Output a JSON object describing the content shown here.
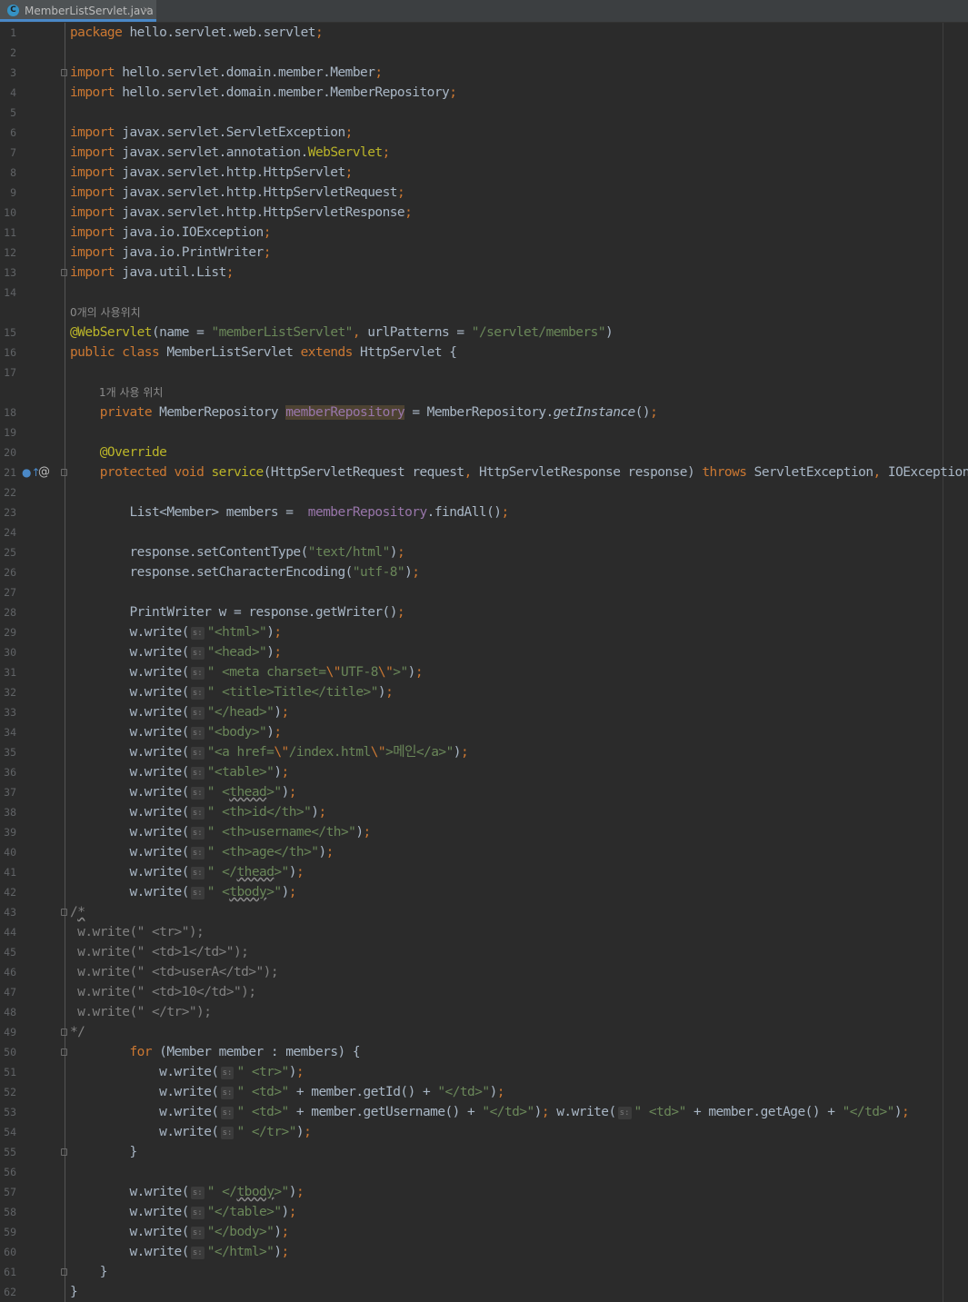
{
  "tab": {
    "icon": "class-icon",
    "title": "MemberListServlet.java"
  },
  "hints": {
    "class_usages": "0개의 사용위치",
    "field_usages": "1개 사용 위치"
  },
  "gutter": {
    "override_icon": "override-up-arrow-icon",
    "at_icon": "annotation-at-icon"
  },
  "param_hint": "s:",
  "lines": [
    {
      "n": "1",
      "hint": null,
      "parts": [
        [
          "package",
          "kw"
        ],
        [
          " hello.servlet.web.servlet",
          ""
        ],
        [
          ";",
          "kw"
        ]
      ]
    },
    {
      "n": "2",
      "hint": null,
      "parts": []
    },
    {
      "n": "3",
      "hint": null,
      "parts": [
        [
          "import",
          "kw"
        ],
        [
          " hello.servlet.domain.member.Member",
          ""
        ],
        [
          ";",
          "kw"
        ]
      ]
    },
    {
      "n": "4",
      "hint": null,
      "parts": [
        [
          "import",
          "kw"
        ],
        [
          " hello.servlet.domain.member.MemberRepository",
          ""
        ],
        [
          ";",
          "kw"
        ]
      ]
    },
    {
      "n": "5",
      "hint": null,
      "parts": []
    },
    {
      "n": "6",
      "hint": null,
      "parts": [
        [
          "import",
          "kw"
        ],
        [
          " javax.servlet.ServletException",
          ""
        ],
        [
          ";",
          "kw"
        ]
      ]
    },
    {
      "n": "7",
      "hint": null,
      "parts": [
        [
          "import",
          "kw"
        ],
        [
          " javax.servlet.annotation.",
          ""
        ],
        [
          "WebServlet",
          "ann"
        ],
        [
          ";",
          "kw"
        ]
      ]
    },
    {
      "n": "8",
      "hint": null,
      "parts": [
        [
          "import",
          "kw"
        ],
        [
          " javax.servlet.http.HttpServlet",
          ""
        ],
        [
          ";",
          "kw"
        ]
      ]
    },
    {
      "n": "9",
      "hint": null,
      "parts": [
        [
          "import",
          "kw"
        ],
        [
          " javax.servlet.http.HttpServletRequest",
          ""
        ],
        [
          ";",
          "kw"
        ]
      ]
    },
    {
      "n": "10",
      "hint": null,
      "parts": [
        [
          "import",
          "kw"
        ],
        [
          " javax.servlet.http.HttpServletResponse",
          ""
        ],
        [
          ";",
          "kw"
        ]
      ]
    },
    {
      "n": "11",
      "hint": null,
      "parts": [
        [
          "import",
          "kw"
        ],
        [
          " java.io.IOException",
          ""
        ],
        [
          ";",
          "kw"
        ]
      ]
    },
    {
      "n": "12",
      "hint": null,
      "parts": [
        [
          "import",
          "kw"
        ],
        [
          " java.io.PrintWriter",
          ""
        ],
        [
          ";",
          "kw"
        ]
      ]
    },
    {
      "n": "13",
      "hint": null,
      "parts": [
        [
          "import",
          "kw"
        ],
        [
          " java.util.List",
          ""
        ],
        [
          ";",
          "kw"
        ]
      ]
    },
    {
      "n": "14",
      "hint": null,
      "parts": []
    },
    {
      "n": "",
      "hint": "class_usages",
      "parts": []
    },
    {
      "n": "15",
      "hint": null,
      "parts": [
        [
          "@WebServlet",
          "ann"
        ],
        [
          "(name = ",
          ""
        ],
        [
          "\"memberListServlet\"",
          "str"
        ],
        [
          ", ",
          "kw"
        ],
        [
          "urlPatterns = ",
          ""
        ],
        [
          "\"/servlet/members\"",
          "str"
        ],
        [
          ")",
          ""
        ]
      ]
    },
    {
      "n": "16",
      "hint": null,
      "parts": [
        [
          "public class",
          "kw"
        ],
        [
          " MemberListServlet ",
          ""
        ],
        [
          "extends",
          "kw"
        ],
        [
          " HttpServlet {",
          ""
        ]
      ]
    },
    {
      "n": "17",
      "hint": null,
      "parts": []
    },
    {
      "n": "",
      "hint": "field_usages",
      "parts": []
    },
    {
      "n": "18",
      "hint": null,
      "parts": [
        [
          "    ",
          ""
        ],
        [
          "private",
          "kw"
        ],
        [
          " MemberRepository ",
          ""
        ],
        [
          "memberRepository",
          "fld hl"
        ],
        [
          " = MemberRepository.",
          ""
        ],
        [
          "getInstance",
          "it"
        ],
        [
          "()",
          ""
        ],
        [
          ";",
          "kw"
        ]
      ]
    },
    {
      "n": "19",
      "hint": null,
      "parts": []
    },
    {
      "n": "20",
      "hint": null,
      "parts": [
        [
          "    ",
          ""
        ],
        [
          "@Override",
          "ann"
        ]
      ]
    },
    {
      "n": "21",
      "hint": null,
      "parts": [
        [
          "    ",
          ""
        ],
        [
          "protected void",
          "kw"
        ],
        [
          " ",
          ""
        ],
        [
          "service",
          "ann"
        ],
        [
          "(HttpServletRequest request",
          ""
        ],
        [
          ", ",
          "kw"
        ],
        [
          "HttpServletResponse response) ",
          ""
        ],
        [
          "throws",
          "kw"
        ],
        [
          " ServletException",
          ""
        ],
        [
          ", ",
          "kw"
        ],
        [
          "IOException {",
          ""
        ]
      ]
    },
    {
      "n": "22",
      "hint": null,
      "parts": []
    },
    {
      "n": "23",
      "hint": null,
      "parts": [
        [
          "        List<Member> members =  ",
          ""
        ],
        [
          "memberRepository",
          "fld"
        ],
        [
          ".findAll()",
          ""
        ],
        [
          ";",
          "kw"
        ]
      ]
    },
    {
      "n": "24",
      "hint": null,
      "parts": []
    },
    {
      "n": "25",
      "hint": null,
      "parts": [
        [
          "        response.setContentType(",
          ""
        ],
        [
          "\"text/html\"",
          "str"
        ],
        [
          ")",
          ""
        ],
        [
          ";",
          "kw"
        ]
      ]
    },
    {
      "n": "26",
      "hint": null,
      "parts": [
        [
          "        response.setCharacterEncoding(",
          ""
        ],
        [
          "\"utf-8\"",
          "str"
        ],
        [
          ")",
          ""
        ],
        [
          ";",
          "kw"
        ]
      ]
    },
    {
      "n": "27",
      "hint": null,
      "parts": []
    },
    {
      "n": "28",
      "hint": null,
      "parts": [
        [
          "        PrintWriter w = response.getWriter()",
          ""
        ],
        [
          ";",
          "kw"
        ]
      ]
    },
    {
      "n": "29",
      "hint": null,
      "parts": [
        [
          "        w.write(",
          ""
        ],
        [
          "",
          "ph"
        ],
        [
          "\"<html>\"",
          "str"
        ],
        [
          ")",
          ""
        ],
        [
          ";",
          "kw"
        ]
      ]
    },
    {
      "n": "30",
      "hint": null,
      "parts": [
        [
          "        w.write(",
          ""
        ],
        [
          "",
          "ph"
        ],
        [
          "\"<head>\"",
          "str"
        ],
        [
          ")",
          ""
        ],
        [
          ";",
          "kw"
        ]
      ]
    },
    {
      "n": "31",
      "hint": null,
      "parts": [
        [
          "        w.write(",
          ""
        ],
        [
          "",
          "ph"
        ],
        [
          "\" <meta charset=",
          "str"
        ],
        [
          "\\\"",
          "kw"
        ],
        [
          "UTF-8",
          "str"
        ],
        [
          "\\\"",
          "kw"
        ],
        [
          ">\"",
          "str"
        ],
        [
          ")",
          ""
        ],
        [
          ";",
          "kw"
        ]
      ]
    },
    {
      "n": "32",
      "hint": null,
      "parts": [
        [
          "        w.write(",
          ""
        ],
        [
          "",
          "ph"
        ],
        [
          "\" <title>Title</title>\"",
          "str"
        ],
        [
          ")",
          ""
        ],
        [
          ";",
          "kw"
        ]
      ]
    },
    {
      "n": "33",
      "hint": null,
      "parts": [
        [
          "        w.write(",
          ""
        ],
        [
          "",
          "ph"
        ],
        [
          "\"</head>\"",
          "str"
        ],
        [
          ")",
          ""
        ],
        [
          ";",
          "kw"
        ]
      ]
    },
    {
      "n": "34",
      "hint": null,
      "parts": [
        [
          "        w.write(",
          ""
        ],
        [
          "",
          "ph"
        ],
        [
          "\"<body>\"",
          "str"
        ],
        [
          ")",
          ""
        ],
        [
          ";",
          "kw"
        ]
      ]
    },
    {
      "n": "35",
      "hint": null,
      "parts": [
        [
          "        w.write(",
          ""
        ],
        [
          "",
          "ph"
        ],
        [
          "\"<a href=",
          "str"
        ],
        [
          "\\\"",
          "kw"
        ],
        [
          "/index.html",
          "str"
        ],
        [
          "\\\"",
          "kw"
        ],
        [
          ">메인</a>\"",
          "str"
        ],
        [
          ")",
          ""
        ],
        [
          ";",
          "kw"
        ]
      ]
    },
    {
      "n": "36",
      "hint": null,
      "parts": [
        [
          "        w.write(",
          ""
        ],
        [
          "",
          "ph"
        ],
        [
          "\"<table>\"",
          "str"
        ],
        [
          ")",
          ""
        ],
        [
          ";",
          "kw"
        ]
      ]
    },
    {
      "n": "37",
      "hint": null,
      "parts": [
        [
          "        w.write(",
          ""
        ],
        [
          "",
          "ph"
        ],
        [
          "\" <",
          "str"
        ],
        [
          "thead",
          "str u"
        ],
        [
          ">\"",
          "str"
        ],
        [
          ")",
          ""
        ],
        [
          ";",
          "kw"
        ]
      ]
    },
    {
      "n": "38",
      "hint": null,
      "parts": [
        [
          "        w.write(",
          ""
        ],
        [
          "",
          "ph"
        ],
        [
          "\" <th>id</th>\"",
          "str"
        ],
        [
          ")",
          ""
        ],
        [
          ";",
          "kw"
        ]
      ]
    },
    {
      "n": "39",
      "hint": null,
      "parts": [
        [
          "        w.write(",
          ""
        ],
        [
          "",
          "ph"
        ],
        [
          "\" <th>username</th>\"",
          "str"
        ],
        [
          ")",
          ""
        ],
        [
          ";",
          "kw"
        ]
      ]
    },
    {
      "n": "40",
      "hint": null,
      "parts": [
        [
          "        w.write(",
          ""
        ],
        [
          "",
          "ph"
        ],
        [
          "\" <th>age</th>\"",
          "str"
        ],
        [
          ")",
          ""
        ],
        [
          ";",
          "kw"
        ]
      ]
    },
    {
      "n": "41",
      "hint": null,
      "parts": [
        [
          "        w.write(",
          ""
        ],
        [
          "",
          "ph"
        ],
        [
          "\" </",
          "str"
        ],
        [
          "thead",
          "str u"
        ],
        [
          ">\"",
          "str"
        ],
        [
          ")",
          ""
        ],
        [
          ";",
          "kw"
        ]
      ]
    },
    {
      "n": "42",
      "hint": null,
      "parts": [
        [
          "        w.write(",
          ""
        ],
        [
          "",
          "ph"
        ],
        [
          "\" <",
          "str"
        ],
        [
          "tbody",
          "str u"
        ],
        [
          ">\"",
          "str"
        ],
        [
          ")",
          ""
        ],
        [
          ";",
          "kw"
        ]
      ]
    },
    {
      "n": "43",
      "hint": null,
      "parts": [
        [
          "/",
          "cm"
        ],
        [
          "*",
          "cm u"
        ]
      ]
    },
    {
      "n": "44",
      "hint": null,
      "parts": [
        [
          " w.write(\" <tr>\");",
          "cm"
        ]
      ]
    },
    {
      "n": "45",
      "hint": null,
      "parts": [
        [
          " w.write(\" <td>1</td>\");",
          "cm"
        ]
      ]
    },
    {
      "n": "46",
      "hint": null,
      "parts": [
        [
          " w.write(\" <td>userA</td>\");",
          "cm"
        ]
      ]
    },
    {
      "n": "47",
      "hint": null,
      "parts": [
        [
          " w.write(\" <td>10</td>\");",
          "cm"
        ]
      ]
    },
    {
      "n": "48",
      "hint": null,
      "parts": [
        [
          " w.write(\" </tr>\");",
          "cm"
        ]
      ]
    },
    {
      "n": "49",
      "hint": null,
      "parts": [
        [
          "*/",
          "cm"
        ]
      ]
    },
    {
      "n": "50",
      "hint": null,
      "parts": [
        [
          "        ",
          ""
        ],
        [
          "for",
          "kw"
        ],
        [
          " (Member member : members) {",
          ""
        ]
      ]
    },
    {
      "n": "51",
      "hint": null,
      "parts": [
        [
          "            w.write(",
          ""
        ],
        [
          "",
          "ph"
        ],
        [
          "\" <tr>\"",
          "str"
        ],
        [
          ")",
          ""
        ],
        [
          ";",
          "kw"
        ]
      ]
    },
    {
      "n": "52",
      "hint": null,
      "parts": [
        [
          "            w.write(",
          ""
        ],
        [
          "",
          "ph"
        ],
        [
          "\" <td>\"",
          "str"
        ],
        [
          " + member.getId() + ",
          ""
        ],
        [
          "\"</td>\"",
          "str"
        ],
        [
          ")",
          ""
        ],
        [
          ";",
          "kw"
        ]
      ]
    },
    {
      "n": "53",
      "hint": null,
      "parts": [
        [
          "            w.write(",
          ""
        ],
        [
          "",
          "ph"
        ],
        [
          "\" <td>\"",
          "str"
        ],
        [
          " + member.getUsername() + ",
          ""
        ],
        [
          "\"</td>\"",
          "str"
        ],
        [
          ")",
          ""
        ],
        [
          ";",
          "kw"
        ],
        [
          " w.write(",
          ""
        ],
        [
          "",
          "ph"
        ],
        [
          "\" <td>\"",
          "str"
        ],
        [
          " + member.getAge() + ",
          ""
        ],
        [
          "\"</td>\"",
          "str"
        ],
        [
          ")",
          ""
        ],
        [
          ";",
          "kw"
        ]
      ]
    },
    {
      "n": "54",
      "hint": null,
      "parts": [
        [
          "            w.write(",
          ""
        ],
        [
          "",
          "ph"
        ],
        [
          "\" </tr>\"",
          "str"
        ],
        [
          ")",
          ""
        ],
        [
          ";",
          "kw"
        ]
      ]
    },
    {
      "n": "55",
      "hint": null,
      "parts": [
        [
          "        }",
          ""
        ]
      ]
    },
    {
      "n": "56",
      "hint": null,
      "parts": []
    },
    {
      "n": "57",
      "hint": null,
      "parts": [
        [
          "        w.write(",
          ""
        ],
        [
          "",
          "ph"
        ],
        [
          "\" </",
          "str"
        ],
        [
          "tbody",
          "str u"
        ],
        [
          ">\"",
          "str"
        ],
        [
          ")",
          ""
        ],
        [
          ";",
          "kw"
        ]
      ]
    },
    {
      "n": "58",
      "hint": null,
      "parts": [
        [
          "        w.write(",
          ""
        ],
        [
          "",
          "ph"
        ],
        [
          "\"</table>\"",
          "str"
        ],
        [
          ")",
          ""
        ],
        [
          ";",
          "kw"
        ]
      ]
    },
    {
      "n": "59",
      "hint": null,
      "parts": [
        [
          "        w.write(",
          ""
        ],
        [
          "",
          "ph"
        ],
        [
          "\"</body>\"",
          "str"
        ],
        [
          ")",
          ""
        ],
        [
          ";",
          "kw"
        ]
      ]
    },
    {
      "n": "60",
      "hint": null,
      "parts": [
        [
          "        w.write(",
          ""
        ],
        [
          "",
          "ph"
        ],
        [
          "\"</html>\"",
          "str"
        ],
        [
          ")",
          ""
        ],
        [
          ";",
          "kw"
        ]
      ]
    },
    {
      "n": "61",
      "hint": null,
      "parts": [
        [
          "    }",
          ""
        ]
      ]
    },
    {
      "n": "62",
      "hint": null,
      "parts": [
        [
          "}",
          ""
        ]
      ]
    }
  ]
}
